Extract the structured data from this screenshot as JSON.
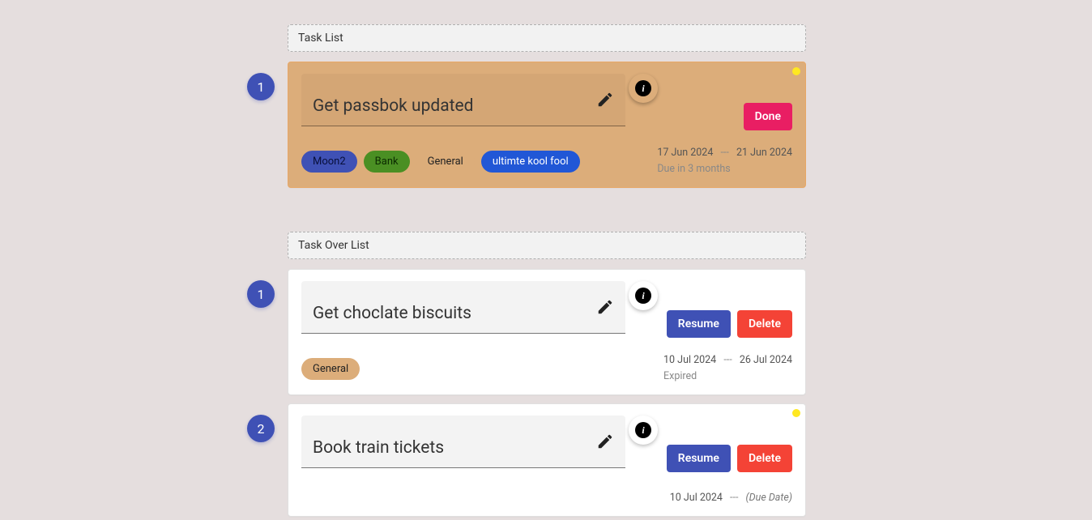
{
  "sections": {
    "task_list": {
      "title": "Task List"
    },
    "task_over_list": {
      "title": "Task Over List"
    }
  },
  "active_tasks": [
    {
      "index": "1",
      "title": "Get passbok updated",
      "tags": [
        {
          "label": "Moon2",
          "style": "navy"
        },
        {
          "label": "Bank",
          "style": "green"
        },
        {
          "label": "General",
          "style": "tan"
        },
        {
          "label": "ultimte kool fool",
          "style": "blue"
        }
      ],
      "start_date": "17 Jun 2024",
      "due_date": "21 Jun 2024",
      "status": "Due in 3 months",
      "done_label": "Done",
      "has_corner_dot": true
    }
  ],
  "over_tasks": [
    {
      "index": "1",
      "title": "Get choclate biscuits",
      "tags": [
        {
          "label": "General",
          "style": "tan"
        }
      ],
      "start_date": "10 Jul 2024",
      "due_date": "26 Jul 2024",
      "status": "Expired",
      "resume_label": "Resume",
      "delete_label": "Delete",
      "has_corner_dot": false
    },
    {
      "index": "2",
      "title": "Book train tickets",
      "tags": [],
      "start_date": "10 Jul 2024",
      "due_date": "(Due Date)",
      "due_date_is_placeholder": true,
      "status": "",
      "resume_label": "Resume",
      "delete_label": "Delete",
      "has_corner_dot": true
    }
  ],
  "date_separator": "---"
}
